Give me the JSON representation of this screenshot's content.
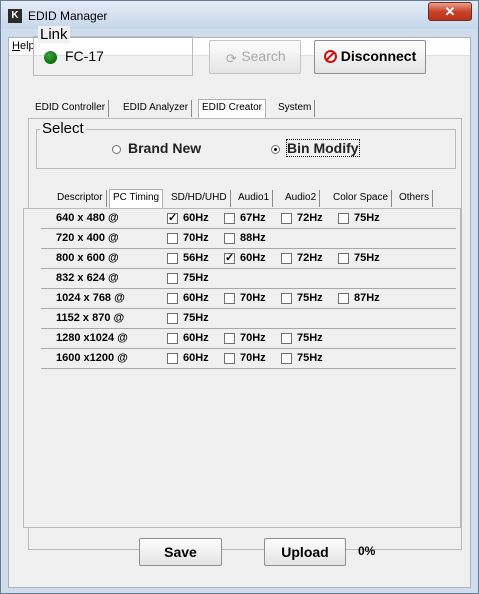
{
  "window": {
    "title": "EDID Manager",
    "close_glyph": "✕",
    "app_icon": "K"
  },
  "menu": {
    "help_label": "Help",
    "help_mnemonic": "H"
  },
  "link": {
    "group_title": "Link",
    "device": "FC-17",
    "status_color": "#0a7a0a",
    "search_label": "Search",
    "search_icon": "refresh-search-icon",
    "disconnect_label": "Disconnect",
    "disconnect_icon": "stop-icon"
  },
  "main_tabs": [
    {
      "label": "EDID Controller"
    },
    {
      "label": "EDID Analyzer"
    },
    {
      "label": "EDID Creator",
      "active": true
    },
    {
      "label": "System"
    }
  ],
  "select": {
    "group_title": "Select",
    "options": [
      {
        "label": "Brand New",
        "selected": false
      },
      {
        "label": "Bin Modify",
        "selected": true
      }
    ]
  },
  "creator_tabs": [
    {
      "label": "Descriptor"
    },
    {
      "label": "PC Timing",
      "active": true
    },
    {
      "label": "SD/HD/UHD"
    },
    {
      "label": "Audio1"
    },
    {
      "label": "Audio2"
    },
    {
      "label": "Color Space"
    },
    {
      "label": "Others"
    }
  ],
  "pc_timing": [
    {
      "res": "640 x 480 @",
      "rates": [
        {
          "hz": "60Hz",
          "checked": true
        },
        {
          "hz": "67Hz",
          "checked": false
        },
        {
          "hz": "72Hz",
          "checked": false
        },
        {
          "hz": "75Hz",
          "checked": false
        }
      ]
    },
    {
      "res": "720 x 400 @",
      "rates": [
        {
          "hz": "70Hz",
          "checked": false
        },
        {
          "hz": "88Hz",
          "checked": false
        }
      ]
    },
    {
      "res": "800 x 600 @",
      "rates": [
        {
          "hz": "56Hz",
          "checked": false
        },
        {
          "hz": "60Hz",
          "checked": true
        },
        {
          "hz": "72Hz",
          "checked": false
        },
        {
          "hz": "75Hz",
          "checked": false
        }
      ]
    },
    {
      "res": "832 x 624 @",
      "rates": [
        {
          "hz": "75Hz",
          "checked": false
        }
      ]
    },
    {
      "res": "1024 x 768 @",
      "rates": [
        {
          "hz": "60Hz",
          "checked": false
        },
        {
          "hz": "70Hz",
          "checked": false
        },
        {
          "hz": "75Hz",
          "checked": false
        },
        {
          "hz": "87Hz",
          "checked": false
        }
      ]
    },
    {
      "res": "1152 x 870 @",
      "rates": [
        {
          "hz": "75Hz",
          "checked": false
        }
      ]
    },
    {
      "res": "1280 x1024 @",
      "rates": [
        {
          "hz": "60Hz",
          "checked": false
        },
        {
          "hz": "70Hz",
          "checked": false
        },
        {
          "hz": "75Hz",
          "checked": false
        }
      ]
    },
    {
      "res": "1600 x1200 @",
      "rates": [
        {
          "hz": "60Hz",
          "checked": false
        },
        {
          "hz": "70Hz",
          "checked": false
        },
        {
          "hz": "75Hz",
          "checked": false
        }
      ]
    }
  ],
  "actions": {
    "save_label": "Save",
    "upload_label": "Upload",
    "progress": "0%"
  }
}
